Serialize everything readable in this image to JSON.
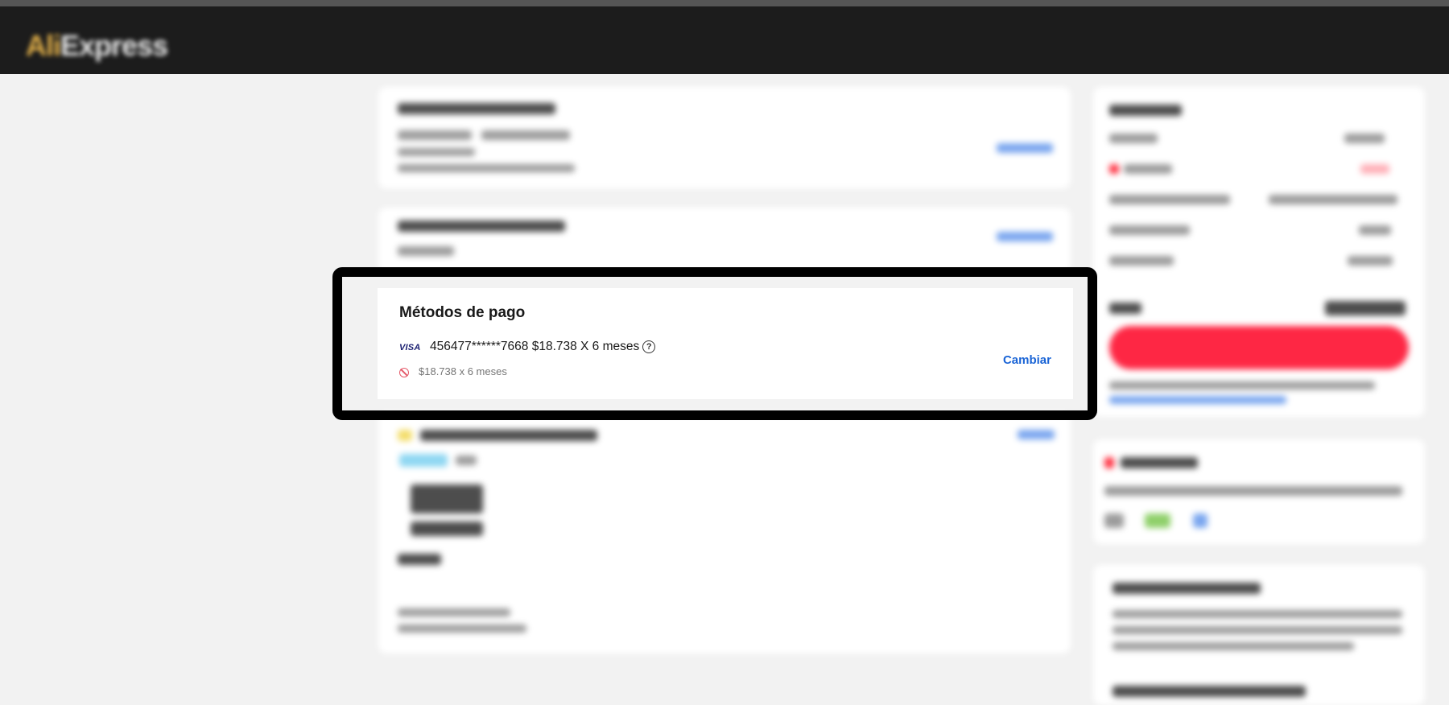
{
  "header": {
    "logo_text_a": "Ali",
    "logo_text_b": "Express"
  },
  "payment": {
    "title": "Métodos de pago",
    "card_brand": "VISA",
    "card_line": "456477******7668 $18.738 X 6 meses",
    "installment_note": "$18.738 x 6 meses",
    "change_label": "Cambiar",
    "help_icon": "?"
  },
  "colors": {
    "accent_link": "#1a64d6",
    "primary_button": "#fe2744",
    "header_bg": "#1c1c1c"
  }
}
